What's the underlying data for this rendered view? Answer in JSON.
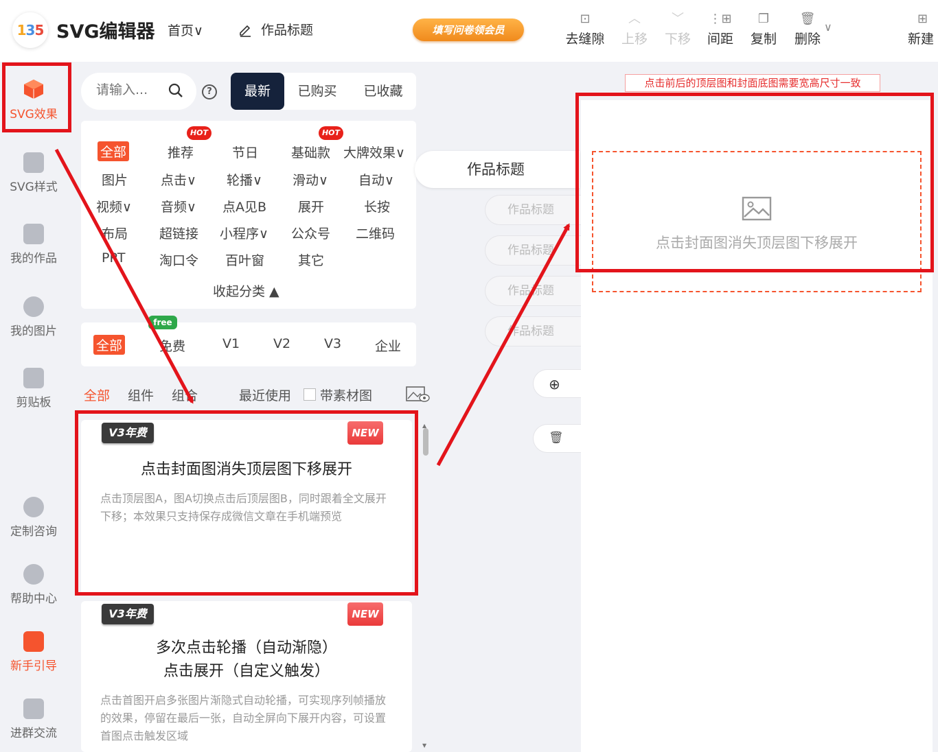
{
  "topbar": {
    "logo_parts": [
      "1",
      "3",
      "5"
    ],
    "app_title": "SVG编辑器",
    "home_menu": "首页∨",
    "work_title": "作品标题",
    "promo_label": "填写问卷领会员",
    "tools": [
      {
        "label": "去缝隙",
        "icon": "gap-icon",
        "disabled": false
      },
      {
        "label": "上移",
        "icon": "arrow-up-icon",
        "disabled": true
      },
      {
        "label": "下移",
        "icon": "arrow-down-icon",
        "disabled": true
      },
      {
        "label": "间距",
        "icon": "spacing-icon",
        "disabled": false
      },
      {
        "label": "复制",
        "icon": "copy-icon",
        "disabled": false
      },
      {
        "label": "删除",
        "icon": "trash-icon",
        "disabled": false
      },
      {
        "label": "新建",
        "icon": "new-file-icon",
        "disabled": false
      }
    ]
  },
  "rail": {
    "items": [
      {
        "label": "SVG效果",
        "icon": "cube-icon",
        "active": true
      },
      {
        "label": "SVG样式",
        "icon": "style-icon"
      },
      {
        "label": "我的作品",
        "icon": "folder-icon"
      },
      {
        "label": "我的图片",
        "icon": "cloud-upload-icon"
      },
      {
        "label": "剪贴板",
        "icon": "clipboard-icon"
      },
      {
        "label": "定制咨询",
        "icon": "headset-icon"
      },
      {
        "label": "帮助中心",
        "icon": "help-icon"
      },
      {
        "label": "新手引导",
        "icon": "guide-icon"
      },
      {
        "label": "进群交流",
        "icon": "chat-icon"
      }
    ]
  },
  "panel": {
    "search_placeholder": "请输入...",
    "segments": [
      "最新",
      "已购买",
      "已收藏"
    ],
    "hot_badge": "HOT",
    "categories": [
      "全部",
      "推荐",
      "节日",
      "基础款",
      "大牌效果∨",
      "图片",
      "点击∨",
      "轮播∨",
      "滑动∨",
      "自动∨",
      "视频∨",
      "音频∨",
      "点A见B",
      "展开",
      "长按",
      "布局",
      "超链接",
      "小程序∨",
      "公众号",
      "二维码",
      "PPT",
      "淘口令",
      "百叶窗",
      "其它"
    ],
    "collapse_label": "收起分类",
    "free_badge": "free",
    "versions": [
      "全部",
      "免费",
      "V1",
      "V2",
      "V3",
      "企业"
    ],
    "filters": [
      "全部",
      "组件",
      "组合",
      "最近使用",
      "带素材图"
    ],
    "templates": [
      {
        "badge": "V3年费",
        "new_badge": "NEW",
        "title_lines": [
          "点击封面图消失顶层图下移展开"
        ],
        "desc": "点击顶层图A，图A切换点击后顶层图B，同时跟着全文展开下移；本效果只支持保存成微信文章在手机端预览"
      },
      {
        "badge": "V3年费",
        "new_badge": "NEW",
        "title_lines": [
          "多次点击轮播（自动渐隐）",
          "点击展开（自定义触发）"
        ],
        "desc": "点击首图开启多张图片渐隐式自动轮播，可实现序列帧播放的效果，停留在最后一张，自动全屏向下展开内容，可设置首图点击触发区域"
      }
    ]
  },
  "pages": {
    "main": "作品标题",
    "items": [
      "作品标题",
      "作品标题",
      "作品标题",
      "作品标题"
    ],
    "add_icon": "⊕",
    "delete_icon": "🗑"
  },
  "canvas": {
    "warning": "点击前后的顶层图和封面底图需要宽高尺寸一致",
    "placeholder_text": "点击封面图消失顶层图下移展开"
  },
  "colors": {
    "accent": "#f5542e",
    "annotation": "#e3141b",
    "dark_segment": "#15223b",
    "promo": "#f08a1c"
  }
}
